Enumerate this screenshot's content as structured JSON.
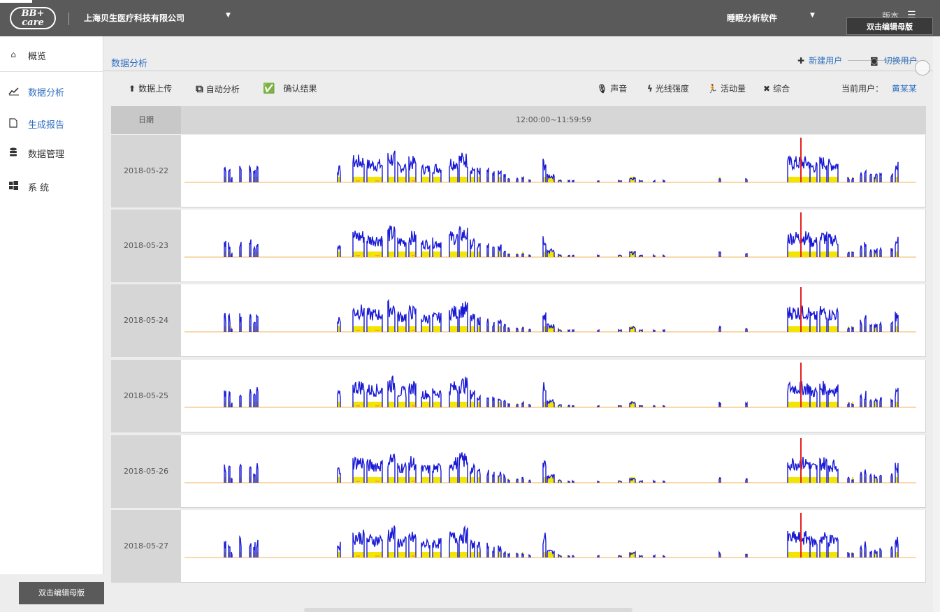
{
  "topbar": {
    "logo_text": "BB+ care",
    "company": "上海贝生医疗科技有限公司",
    "software": "睡眠分析软件",
    "version": "版本",
    "edit_master": "双击编辑母版"
  },
  "sidebar": {
    "items": [
      {
        "label": "概览",
        "icon": "home-icon"
      },
      {
        "label": "数据分析",
        "icon": "chart-icon"
      },
      {
        "label": "生成报告",
        "icon": "document-icon"
      },
      {
        "label": "数据管理",
        "icon": "database-icon"
      },
      {
        "label": "系 统",
        "icon": "windows-icon"
      }
    ],
    "edit_master": "双击编辑母版"
  },
  "main": {
    "title": "数据分析",
    "new_user": "新建用户",
    "switch_user": "切换用户"
  },
  "toolbar": {
    "upload": "数据上传",
    "auto_analysis": "自动分析",
    "confirm": "确认结果",
    "sound": "声音",
    "light": "光线强度",
    "activity": "活动量",
    "combined": "综合",
    "current_user_label": "当前用户：",
    "current_user": "黄某某"
  },
  "table": {
    "col_date": "日期",
    "col_range": "12:00:00~11:59:59",
    "rows": [
      {
        "date": "2018-05-22"
      },
      {
        "date": "2018-05-23"
      },
      {
        "date": "2018-05-24"
      },
      {
        "date": "2018-05-25"
      },
      {
        "date": "2018-05-26"
      },
      {
        "date": "2018-05-27"
      }
    ]
  },
  "colors": {
    "activity": "#1a1ad6",
    "light": "#f2e600",
    "sound": "#ff6a6a",
    "marker": "#e81e1e",
    "baseline": "#f5c27a"
  }
}
